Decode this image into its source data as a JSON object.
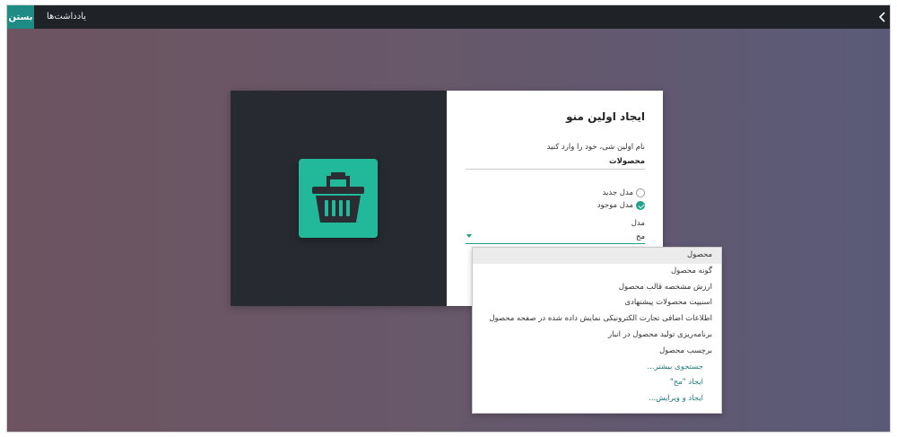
{
  "topbar": {
    "close_label": "بستن",
    "notes_label": "یادداشت‌ها",
    "back_icon": "chevron-left-icon"
  },
  "dialog": {
    "icon": "shopping-basket-icon",
    "title": "ایجاد اولین منو",
    "name_label": "نام اولین شی، خود را وارد کنید",
    "name_value": "محصولات",
    "radio_new": "مدل جدید",
    "radio_existing": "مدل موجود",
    "model_label": "مدل",
    "model_input_value": "مح"
  },
  "dropdown": {
    "items": [
      "محصول",
      "گونه محصول",
      "ارزش مشخصه قالب محصول",
      "اسنیپت محصولات پیشنهادی",
      "اطلاعات اضافی تجارت الکترونیکی نمایش داده شده در صفحه محصول",
      "برنامه‌ریزی تولید محصول در انبار",
      "برچسب محصول"
    ],
    "search_more": "جستجوی بیشتر...",
    "create": "ایجاد \"مح\"",
    "create_edit": "ایجاد و ویرایش..."
  },
  "colors": {
    "accent": "#20a18a",
    "tile": "#22b99a",
    "topbar": "#1f2226",
    "close_button": "#1e8c85",
    "dialog_left": "#272a31",
    "link": "#1e7c78"
  }
}
